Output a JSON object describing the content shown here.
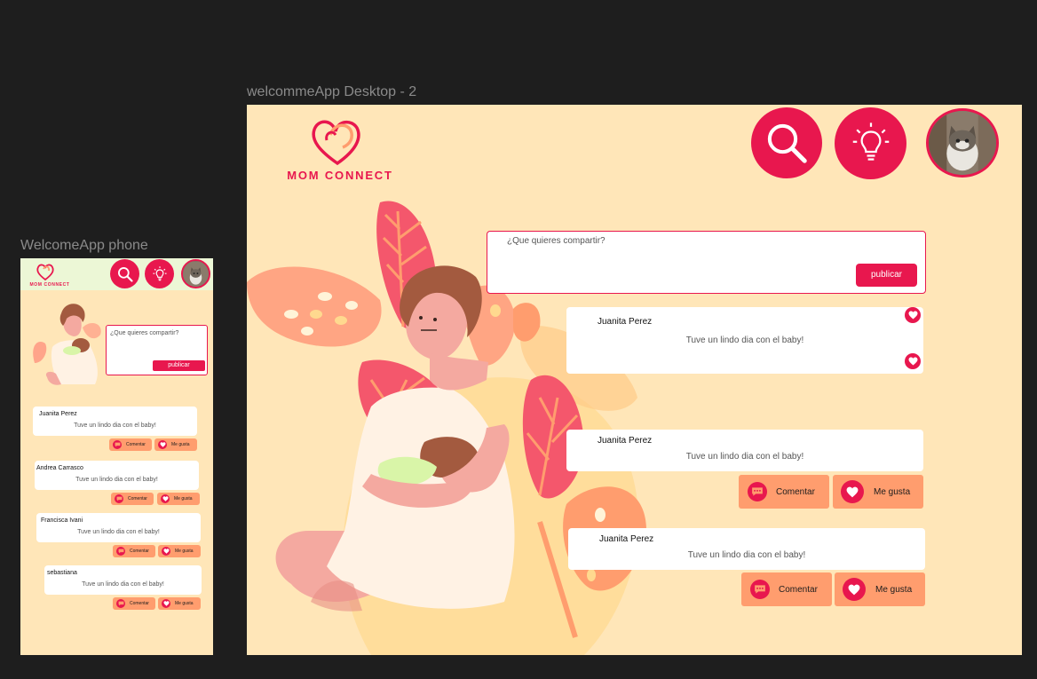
{
  "canvas": {
    "background": "#1e1e1e"
  },
  "colors": {
    "accent": "#e8174e",
    "orange": "#ff9d6e",
    "desktop_bg": "#ffe6b8",
    "phone_header_bg": "#ecf7d6",
    "phone_bg": "#ffe6b8"
  },
  "desktop": {
    "frame_label": "welcommeApp Desktop - 2",
    "brand": "MOM CONNECT",
    "icons": [
      "search-icon",
      "lightbulb-icon",
      "avatar"
    ],
    "composer": {
      "placeholder": "¿Que quieres compartir?",
      "publish_label": "publicar"
    },
    "posts": [
      {
        "author": "Juanita Perez",
        "text": "Tuve un lindo dia con el baby!"
      },
      {
        "author": "Juanita Perez",
        "text": "Tuve un lindo dia con el baby!",
        "comment_label": "Comentar",
        "like_label": "Me gusta"
      },
      {
        "author": "Juanita Perez",
        "text": "Tuve un lindo dia con el baby!",
        "comment_label": "Comentar",
        "like_label": "Me gusta"
      }
    ]
  },
  "phone": {
    "frame_label": "WelcomeApp phone",
    "brand": "MOM CONNECT",
    "composer": {
      "placeholder": "¿Que quieres compartir?",
      "publish_label": "publicar"
    },
    "posts": [
      {
        "author": "Juanita Perez",
        "text": "Tuve un lindo dia con el baby!",
        "comment_label": "Comentar",
        "like_label": "Me gusta"
      },
      {
        "author": "Andrea Carrasco",
        "text": "Tuve un lindo dia con el baby!",
        "comment_label": "Comentar",
        "like_label": "Me gusta"
      },
      {
        "author": "Francisca Ivani",
        "text": "Tuve un lindo dia con el baby!",
        "comment_label": "Comentar",
        "like_label": "Me gusta"
      },
      {
        "author": "sebastiana",
        "text": "Tuve un lindo dia con el baby!",
        "comment_label": "Comentar",
        "like_label": "Me gusta"
      }
    ]
  }
}
